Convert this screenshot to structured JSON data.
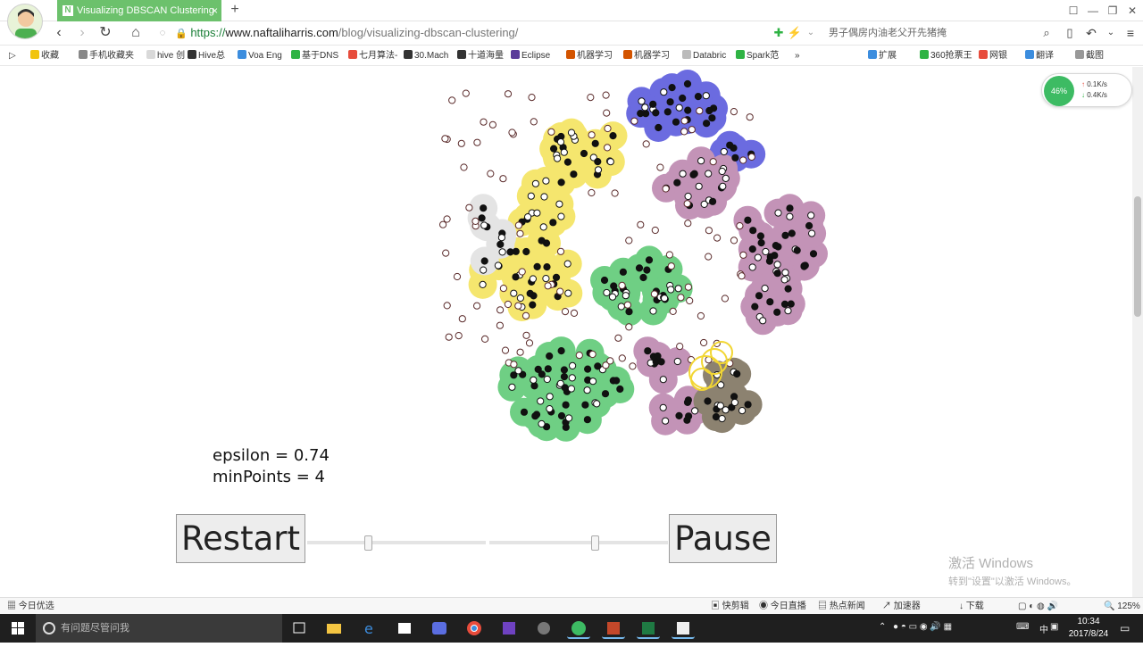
{
  "browser": {
    "tab_title": "Visualizing DBSCAN Clustering",
    "tab_favicon": "N",
    "url_scheme": "https://",
    "url_host": "www.naftaliharris.com",
    "url_path": "/blog/visualizing-dbscan-clustering/",
    "search_placeholder": "男子偶房内油老父开先猪掩",
    "new_tab_glyph": "+"
  },
  "bookmarks": [
    {
      "label": "收藏",
      "color": "#f1c40f"
    },
    {
      "label": "手机收藏夹",
      "color": "#888888"
    },
    {
      "label": "hive 创",
      "color": "#d9d9d9"
    },
    {
      "label": "Hive总",
      "color": "#333333"
    },
    {
      "label": "Voa Eng",
      "color": "#3c8dde"
    },
    {
      "label": "基于DNS",
      "color": "#2fb344"
    },
    {
      "label": "七月算法-",
      "color": "#e74c3c"
    },
    {
      "label": "30.Mach",
      "color": "#333333"
    },
    {
      "label": "十道海量",
      "color": "#333333"
    },
    {
      "label": "Eclipse",
      "color": "#5b3b9a"
    },
    {
      "label": "机器学习",
      "color": "#d35400"
    },
    {
      "label": "机器学习",
      "color": "#d35400"
    },
    {
      "label": "Databric",
      "color": "#bbbbbb"
    },
    {
      "label": "Spark范",
      "color": "#2fb344"
    }
  ],
  "bookmark_overflow": "»",
  "bookmarks_right": [
    {
      "label": "扩展",
      "color": "#3c8dde"
    },
    {
      "label": "360抢票王",
      "color": "#2fb344"
    },
    {
      "label": "网银",
      "color": "#e74c3c"
    },
    {
      "label": "翻译",
      "color": "#3c8dde"
    },
    {
      "label": "截图",
      "color": "#999999"
    }
  ],
  "net_widget": {
    "ball_label": "46%",
    "up": "0.1K/s",
    "down": "0.4K/s"
  },
  "dbscan": {
    "epsilon_label": "epsilon = 0.74",
    "minpoints_label": "minPoints = 4",
    "restart_label": "Restart",
    "pause_label": "Pause",
    "cluster_colors": {
      "yellow": "#f5e66e",
      "blue": "#6b6be0",
      "pink": "#c393b7",
      "green": "#6fcf84",
      "grey": "#e4e4e4",
      "dark": "#8c8270"
    }
  },
  "watermark": {
    "line1": "激活 Windows",
    "line2": "转到\"设置\"以激活 Windows。"
  },
  "statusbar": {
    "left": "今日优选",
    "items": [
      "快剪辑",
      "今日直播",
      "热点新闻",
      "加速器",
      "下载"
    ],
    "zoom": "125%"
  },
  "taskbar": {
    "search_placeholder": "有问题尽管问我",
    "time": "10:34",
    "date": "2017/8/24",
    "ime": "中"
  }
}
